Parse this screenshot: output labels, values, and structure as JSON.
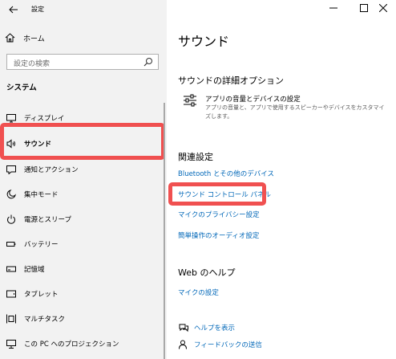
{
  "window": {
    "title": "設定",
    "controls": {
      "minimize": "—",
      "maximize": "☐",
      "close": "✕"
    }
  },
  "sidebar": {
    "home_label": "ホーム",
    "search_placeholder": "設定の検索",
    "section_title": "システム",
    "items": [
      {
        "label": "ディスプレイ",
        "icon": "display-icon"
      },
      {
        "label": "サウンド",
        "icon": "speaker-icon",
        "active": true
      },
      {
        "label": "通知とアクション",
        "icon": "notification-icon"
      },
      {
        "label": "集中モード",
        "icon": "moon-icon"
      },
      {
        "label": "電源とスリープ",
        "icon": "power-icon"
      },
      {
        "label": "バッテリー",
        "icon": "battery-icon"
      },
      {
        "label": "記憶域",
        "icon": "storage-icon"
      },
      {
        "label": "タブレット",
        "icon": "tablet-icon"
      },
      {
        "label": "マルチタスク",
        "icon": "multitask-icon"
      },
      {
        "label": "この PC へのプロジェクション",
        "icon": "projection-icon"
      }
    ],
    "accent_color": "#0a5ad5"
  },
  "main": {
    "title": "サウンド",
    "advanced": {
      "heading": "サウンドの詳細オプション",
      "option_title": "アプリの音量とデバイスの設定",
      "option_desc": "アプリの音量と、アプリで使用するスピーカーやデバイスをカスタマイズします。"
    },
    "related": {
      "heading": "関連設定",
      "links": [
        "Bluetooth とその他のデバイス",
        "サウンド コントロール パネル",
        "マイクのプライバシー設定",
        "簡単操作のオーディオ設定"
      ]
    },
    "web_help": {
      "heading": "Web のヘルプ",
      "link": "マイクの設定"
    },
    "footer": {
      "help": "ヘルプを表示",
      "feedback": "フィードバックの送信"
    },
    "link_color": "#0067b8",
    "highlight_color": "#f05050"
  }
}
